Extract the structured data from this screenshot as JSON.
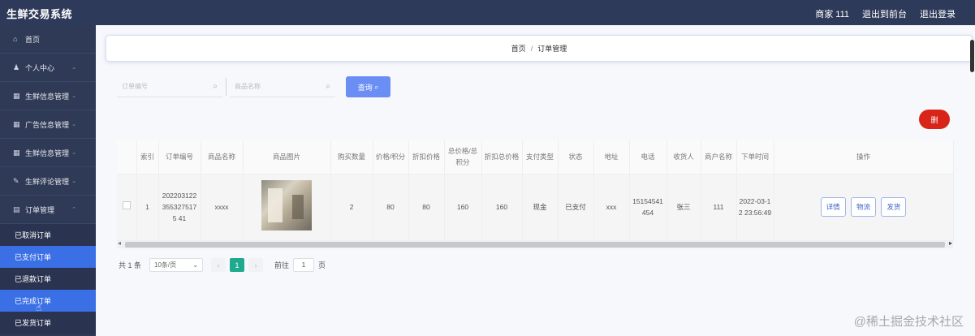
{
  "header": {
    "title": "生鲜交易系统",
    "user": "商家 111",
    "exit_front": "退出到前台",
    "logout": "退出登录"
  },
  "sidebar": {
    "items": [
      {
        "label": "首页",
        "icon": "home-icon"
      },
      {
        "label": "个人中心",
        "icon": "user-icon"
      },
      {
        "label": "生鲜信息管理",
        "icon": "grid-icon"
      },
      {
        "label": "广告信息管理",
        "icon": "grid-icon"
      },
      {
        "label": "生鲜信息管理",
        "icon": "grid-icon"
      },
      {
        "label": "生鲜评论管理",
        "icon": "edit-icon"
      },
      {
        "label": "订单管理",
        "icon": "list-icon"
      }
    ],
    "sub_items": [
      {
        "label": "已取消订单"
      },
      {
        "label": "已支付订单"
      },
      {
        "label": "已退款订单"
      },
      {
        "label": "已完成订单"
      },
      {
        "label": "已发货订单"
      }
    ]
  },
  "breadcrumb": {
    "home": "首页",
    "separator": "/",
    "current": "订单管理"
  },
  "search": {
    "order_placeholder": "订单编号",
    "product_placeholder": "商品名称",
    "query_button": "查询"
  },
  "delete_button": "删",
  "table": {
    "headers": [
      "",
      "索引",
      "订单编号",
      "商品名称",
      "商品图片",
      "购买数量",
      "价格/积分",
      "折扣价格",
      "总价格/总积分",
      "折扣总价格",
      "支付类型",
      "状态",
      "地址",
      "电话",
      "收货人",
      "商户名称",
      "下单时间",
      "操作"
    ],
    "rows": [
      {
        "index": "1",
        "order_no": "2022031223553275175 41",
        "product": "xxxx",
        "quantity": "2",
        "price": "80",
        "discount_price": "80",
        "total": "160",
        "discount_total": "160",
        "pay_type": "现金",
        "status": "已支付",
        "address": "xxx",
        "phone": "15154541454",
        "receiver": "张三",
        "merchant": "111",
        "order_time": "2022-03-12 23:56:49"
      }
    ],
    "actions": [
      "详情",
      "物流",
      "发货"
    ]
  },
  "pager": {
    "total": "共 1 条",
    "page_size": "10条/页",
    "current": "1",
    "goto_label": "前往",
    "goto_value": "1",
    "goto_unit": "页"
  },
  "watermark": "@稀土掘金技术社区",
  "colors": {
    "topbar": "#2e3a59",
    "sidebar": "#2f3a57",
    "active": "#3a6fe6",
    "query": "#6b8ef5",
    "danger": "#d9241a",
    "page": "#1eaa8e"
  }
}
